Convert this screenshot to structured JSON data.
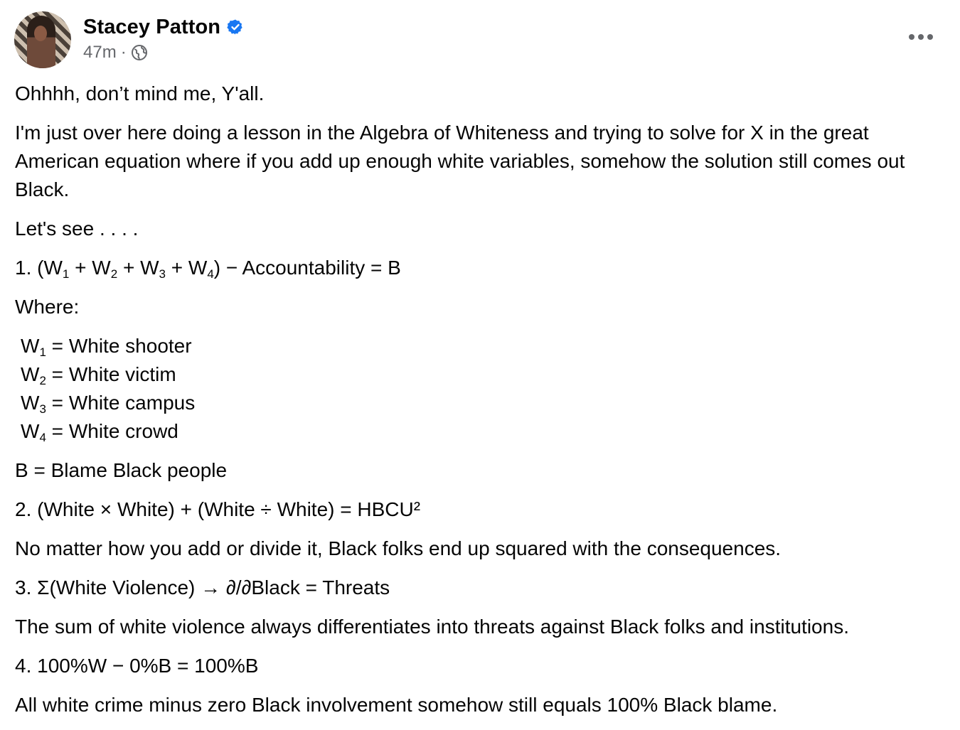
{
  "post": {
    "author": "Stacey Patton",
    "time": "47m",
    "separator": "·",
    "icons": {
      "verified": "verified-badge-icon",
      "audience": "globe-icon",
      "menu": "more-options-icon"
    },
    "colors": {
      "text": "#050505",
      "secondary": "#65676b",
      "verified_blue": "#1877f2"
    },
    "paragraphs": {
      "p1": "Ohhhh, don’t mind me, Y'all.",
      "p2": "I'm just over here doing a lesson in the Algebra of Whiteness and trying to solve for X in the great American equation where if you add up enough white variables, somehow the solution still comes out Black.",
      "p3": "Let's see . . . .",
      "eq1_pre": "1. (W",
      "eq1_plus": " + W",
      "eq1_post": ") − Accountability = B",
      "where": "Where:",
      "b_def": "B = Blame Black people",
      "eq2": "2. (White × White) + (White ÷ White) = HBCU²",
      "eq2_note": "No matter how you add or divide it, Black folks end up squared with the consequences.",
      "eq3": "3. Σ(White Violence) → ∂/∂Black = Threats",
      "eq3_note": "The sum of white violence always differentiates into threats against Black folks and institutions.",
      "eq4": "4. 100%W − 0%B = 100%B",
      "eq4_note": "All white crime minus zero Black involvement somehow still equals 100% Black blame."
    },
    "subscripts": [
      "1",
      "2",
      "3",
      "4"
    ],
    "definitions": [
      {
        "var": "W",
        "sub": "1",
        "text": " = White shooter"
      },
      {
        "var": "W",
        "sub": "2",
        "text": " = White victim"
      },
      {
        "var": "W",
        "sub": "3",
        "text": " = White campus"
      },
      {
        "var": "W",
        "sub": "4",
        "text": " = White crowd"
      }
    ]
  }
}
